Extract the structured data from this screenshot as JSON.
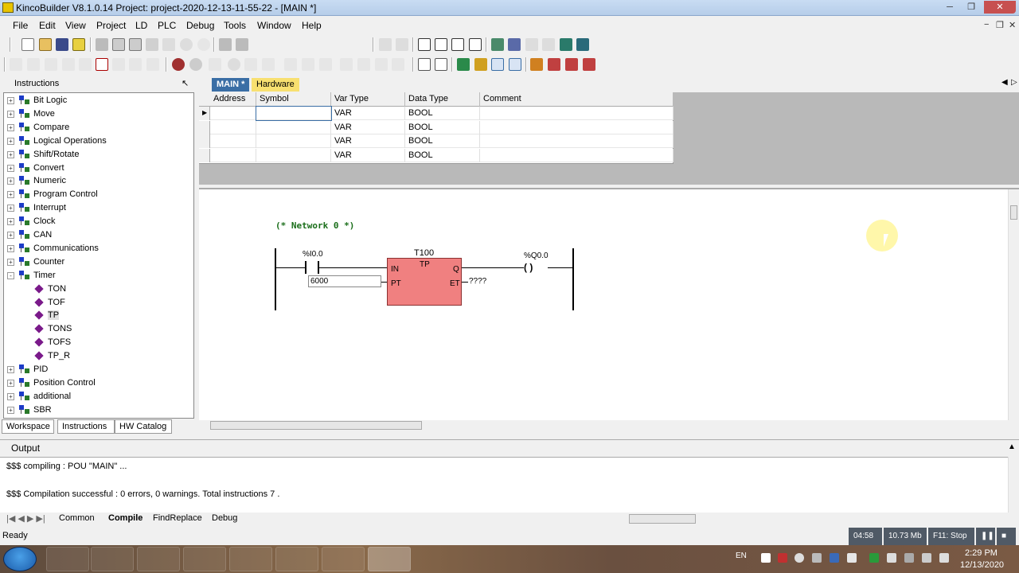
{
  "window": {
    "title": "KincoBuilder V8.1.0.14    Project: project-2020-12-13-11-55-22 - [MAIN *]"
  },
  "menu": [
    "File",
    "Edit",
    "View",
    "Project",
    "LD",
    "PLC",
    "Debug",
    "Tools",
    "Window",
    "Help"
  ],
  "instructions_panel": {
    "title": "Instructions",
    "pin": "↖",
    "items": [
      {
        "label": "Bit Logic",
        "kind": "cat",
        "exp": "+"
      },
      {
        "label": "Move",
        "kind": "cat",
        "exp": "+"
      },
      {
        "label": "Compare",
        "kind": "cat",
        "exp": "+"
      },
      {
        "label": "Logical Operations",
        "kind": "cat",
        "exp": "+"
      },
      {
        "label": "Shift/Rotate",
        "kind": "cat",
        "exp": "+"
      },
      {
        "label": "Convert",
        "kind": "cat",
        "exp": "+"
      },
      {
        "label": "Numeric",
        "kind": "cat",
        "exp": "+"
      },
      {
        "label": "Program Control",
        "kind": "cat",
        "exp": "+"
      },
      {
        "label": "Interrupt",
        "kind": "cat",
        "exp": "+"
      },
      {
        "label": "Clock",
        "kind": "cat",
        "exp": "+"
      },
      {
        "label": "CAN",
        "kind": "cat",
        "exp": "+"
      },
      {
        "label": "Communications",
        "kind": "cat",
        "exp": "+"
      },
      {
        "label": "Counter",
        "kind": "cat",
        "exp": "+"
      },
      {
        "label": "Timer",
        "kind": "cat",
        "exp": "-"
      },
      {
        "label": "TON",
        "kind": "leaf"
      },
      {
        "label": "TOF",
        "kind": "leaf"
      },
      {
        "label": "TP",
        "kind": "leaf",
        "selected": true
      },
      {
        "label": "TONS",
        "kind": "leaf"
      },
      {
        "label": "TOFS",
        "kind": "leaf"
      },
      {
        "label": "TP_R",
        "kind": "leaf"
      },
      {
        "label": "PID",
        "kind": "cat",
        "exp": "+"
      },
      {
        "label": "Position Control",
        "kind": "cat",
        "exp": "+"
      },
      {
        "label": "additional",
        "kind": "cat",
        "exp": "+"
      },
      {
        "label": "SBR",
        "kind": "cat",
        "exp": "+"
      }
    ],
    "tabs": [
      "Workspace",
      "Instructions",
      "HW Catalog"
    ]
  },
  "editor_tabs": [
    {
      "label": "MAIN *",
      "active": true
    },
    {
      "label": "Hardware",
      "active": false
    }
  ],
  "var_table": {
    "headers": [
      "Address",
      "Symbol",
      "Var Type",
      "Data Type",
      "Comment"
    ],
    "rows": [
      {
        "address": "",
        "symbol": "",
        "var_type": "VAR",
        "data_type": "BOOL",
        "comment": ""
      },
      {
        "address": "",
        "symbol": "",
        "var_type": "VAR",
        "data_type": "BOOL",
        "comment": ""
      },
      {
        "address": "",
        "symbol": "",
        "var_type": "VAR",
        "data_type": "BOOL",
        "comment": ""
      },
      {
        "address": "",
        "symbol": "",
        "var_type": "VAR",
        "data_type": "BOOL",
        "comment": ""
      }
    ]
  },
  "ladder": {
    "network_title": "(* Network 0 *)",
    "contact_label": "%I0.0",
    "block_name": "T100",
    "block_type": "TP",
    "in_pin": "IN",
    "pt_pin": "PT",
    "q_pin": "Q",
    "et_pin": "ET",
    "pt_value": "6000",
    "et_value": "????",
    "coil_label": "%Q0.0",
    "coil_symbol": "(   )"
  },
  "output": {
    "title": "Output",
    "lines": [
      "$$$ compiling   : POU \"MAIN\" ...",
      "$$$ Compilation successful   : 0 errors, 0 warnings. Total instructions 7 ."
    ],
    "tabs": [
      "Common",
      "Compile",
      "FindReplace",
      "Debug"
    ],
    "active_tab": "Compile"
  },
  "status": {
    "text": "Ready",
    "time": "04:58",
    "memory": "10.73 Mb",
    "mode": "F11: Stop"
  },
  "taskbar": {
    "lang": "EN",
    "clock_time": "2:29 PM",
    "clock_date": "12/13/2020"
  },
  "colors": {
    "function_block": "#f08080",
    "network_title": "#1a6e1a",
    "active_tab": "#3a6ea5"
  }
}
